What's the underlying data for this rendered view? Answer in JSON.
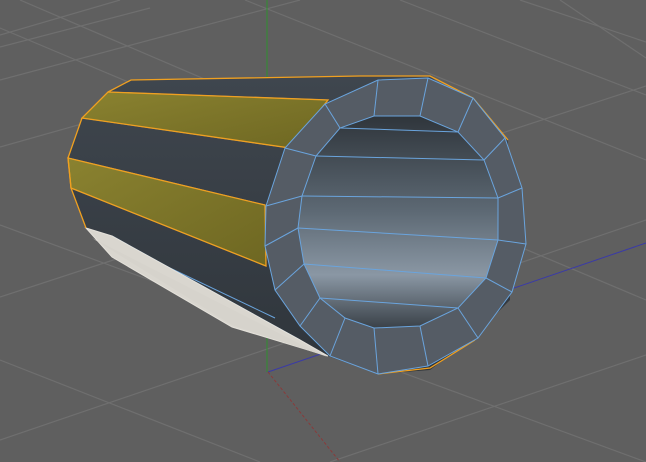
{
  "viewport": {
    "background_color": "#5f5f5f",
    "grid_line_color": "#717171"
  },
  "axes": {
    "x_axis_color": "#3a3aa8",
    "y_axis_color": "#2f8f2f",
    "z_axis_color": "#8a3a3a"
  },
  "object": {
    "type": "tube",
    "outer_face_count": 12,
    "selected_outer_faces": 2,
    "colors": {
      "selected_face": "#7a7224",
      "selection_outline": "#f0a020",
      "face_dark": "#3d444c",
      "face_mid": "#4a525b",
      "rim_face": "#555c65",
      "inner_highlight": "#7c8a98",
      "bottom_face_light": "#d9d6cf",
      "wire_edge": "#6aa4dd"
    }
  }
}
